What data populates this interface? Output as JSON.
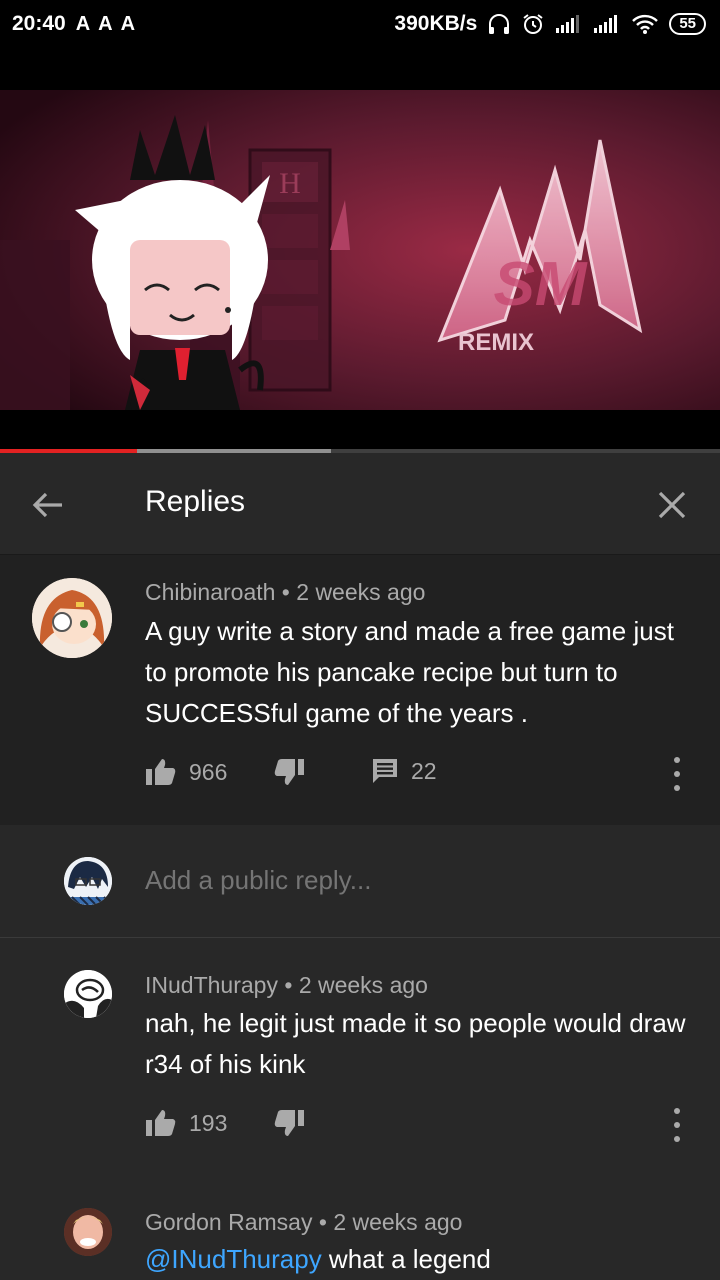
{
  "status_bar": {
    "time": "20:40",
    "notification_icons": [
      "A",
      "A",
      "A"
    ],
    "network_speed": "390KB/s",
    "battery": "55"
  },
  "video": {
    "thumbnail_remix_label": "REMIX",
    "thumbnail_logo_text": "SM",
    "thumbnail_sign_letter": "H",
    "progress_played": 0.19,
    "progress_buffered": 0.46
  },
  "header": {
    "title": "Replies",
    "back_icon": "arrow-left-icon",
    "close_icon": "close-icon"
  },
  "parent_comment": {
    "author": "Chibinaroath",
    "time": "2 weeks ago",
    "text": "A guy write a story and made a free game just to promote his pancake recipe but turn to SUCCESSful game of the years .",
    "likes": "966",
    "replies_count": "22"
  },
  "reply_box": {
    "placeholder": "Add a public reply..."
  },
  "replies": [
    {
      "author": "INudThurapy",
      "time": "2 weeks ago",
      "text": "nah, he legit just made it so people would draw r34 of his kink",
      "likes": "193"
    },
    {
      "author": "Gordon Ramsay",
      "time": "2 weeks ago",
      "mention": "@INudThurapy",
      "text": " what a legend"
    }
  ],
  "separator": " • ",
  "colors": {
    "accent": "#e32222",
    "link": "#3ea6ff",
    "secondary_text": "#aaaaaa",
    "panel": "#282828",
    "highlight_panel": "#212121"
  }
}
